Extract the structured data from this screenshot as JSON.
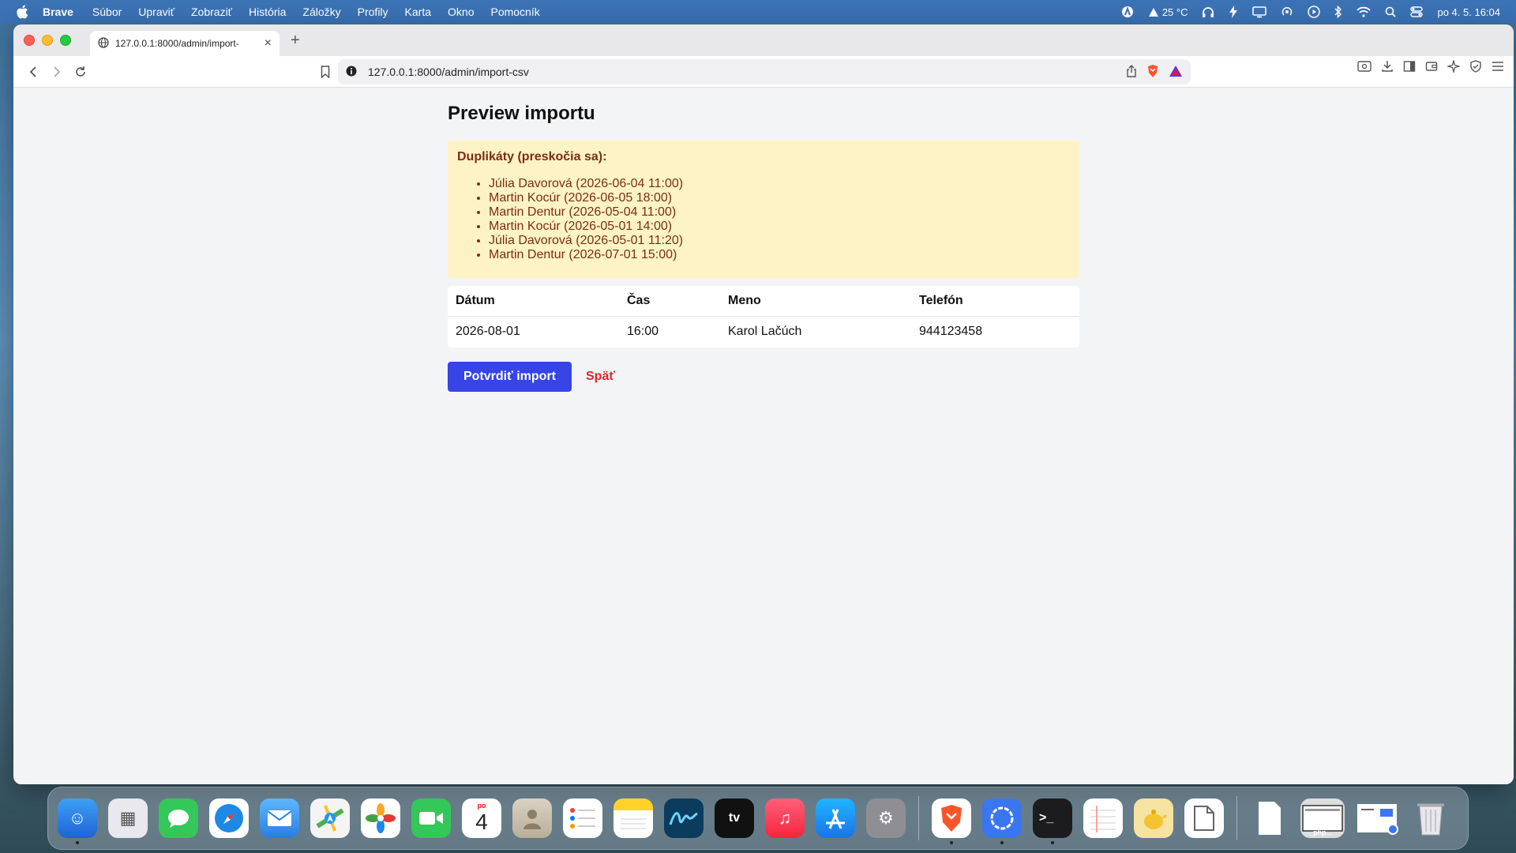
{
  "menubar": {
    "app_name": "Brave",
    "items": [
      "Súbor",
      "Upraviť",
      "Zobraziť",
      "História",
      "Záložky",
      "Profily",
      "Karta",
      "Okno",
      "Pomocník"
    ],
    "weather": "25 °C",
    "datetime": "po 4. 5.  16:04"
  },
  "browser": {
    "tab_title": "127.0.0.1:8000/admin/import-",
    "url": "127.0.0.1:8000/admin/import-csv"
  },
  "page": {
    "title": "Preview importu",
    "duplicates": {
      "heading": "Duplikáty (preskočia sa):",
      "items": [
        "Júlia Davorová (2026-06-04 11:00)",
        "Martin Kocúr (2026-06-05 18:00)",
        "Martin Dentur (2026-05-04 11:00)",
        "Martin Kocúr (2026-05-01 14:00)",
        "Júlia Davorová (2026-05-01 11:20)",
        "Martin Dentur (2026-07-01 15:00)"
      ]
    },
    "table": {
      "headers": [
        "Dátum",
        "Čas",
        "Meno",
        "Telefón"
      ],
      "rows": [
        [
          "2026-08-01",
          "16:00",
          "Karol Lačúch",
          "944123458"
        ]
      ]
    },
    "confirm_label": "Potvrdiť import",
    "back_label": "Späť"
  },
  "dock": {
    "calendar_day": "po",
    "calendar_date": "4",
    "thumb_label": "php..."
  },
  "colors": {
    "menubar": "#3b72b4",
    "warning_bg": "#fef3c7",
    "warning_text": "#7c2d12",
    "primary_button": "#3744e6",
    "back_link": "#dc2626"
  }
}
